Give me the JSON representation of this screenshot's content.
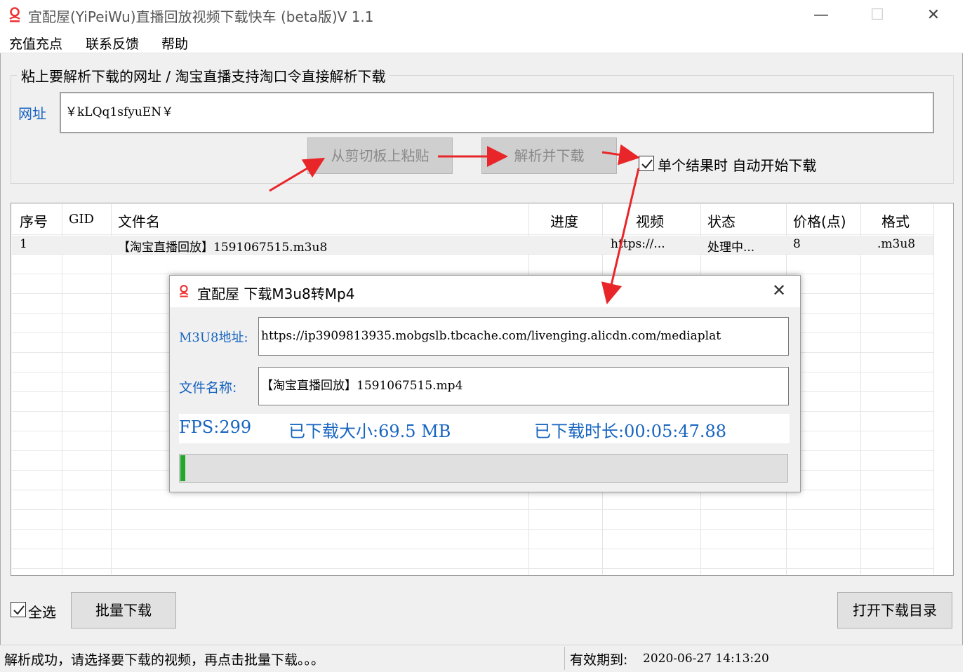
{
  "window": {
    "title": "宜配屋(YiPeiWu)直播回放视频下载快车 (beta版)V 1.1",
    "minimize_glyph": "—",
    "maximize_glyph": "☐",
    "close_glyph": "✕"
  },
  "menu": {
    "items": [
      "充值充点",
      "联系反馈",
      "帮助"
    ]
  },
  "url_group": {
    "title": "粘上要解析下载的网址 / 淘宝直播支持淘口令直接解析下载",
    "label": "网址",
    "value": "￥kLQq1sfyuEN￥",
    "paste_button": "从剪切板上粘贴",
    "parse_button": "解析并下载",
    "auto_download_label": "单个结果时 自动开始下载",
    "auto_download_checked": true
  },
  "table": {
    "headers": [
      "序号",
      "GID",
      "文件名",
      "进度",
      "视频",
      "状态",
      "价格(点)",
      "格式"
    ],
    "rows": [
      [
        "1",
        "",
        "【淘宝直播回放】1591067515.m3u8",
        "",
        "https://...",
        "处理中...",
        "8",
        ".m3u8"
      ]
    ]
  },
  "bottom": {
    "select_all_label": "全选",
    "select_all_checked": true,
    "batch_button": "批量下载",
    "open_dir_button": "打开下载目录"
  },
  "status": {
    "message": "解析成功，请选择要下载的视频，再点击批量下载。。。",
    "expiry_label": "有效期到:",
    "expiry_value": "2020-06-27 14:13:20"
  },
  "dialog": {
    "title": "宜配屋 下载M3u8转Mp4",
    "close_glyph": "✕",
    "m3u8_label": "M3U8地址:",
    "m3u8_value": "https://ip3909813935.mobgslb.tbcache.com/livenging.alicdn.com/mediaplat",
    "filename_label": "文件名称:",
    "filename_value": "【淘宝直播回放】1591067515.mp4",
    "fps": "FPS:299",
    "downloaded_size": "已下载大小:69.5 MB",
    "downloaded_time": "已下载时长:00:05:47.88",
    "progress_fraction": 0.008
  },
  "colors": {
    "accent_blue": "#1764c0",
    "progress_green": "#1fa82a",
    "annotation_red": "#e8262a"
  }
}
